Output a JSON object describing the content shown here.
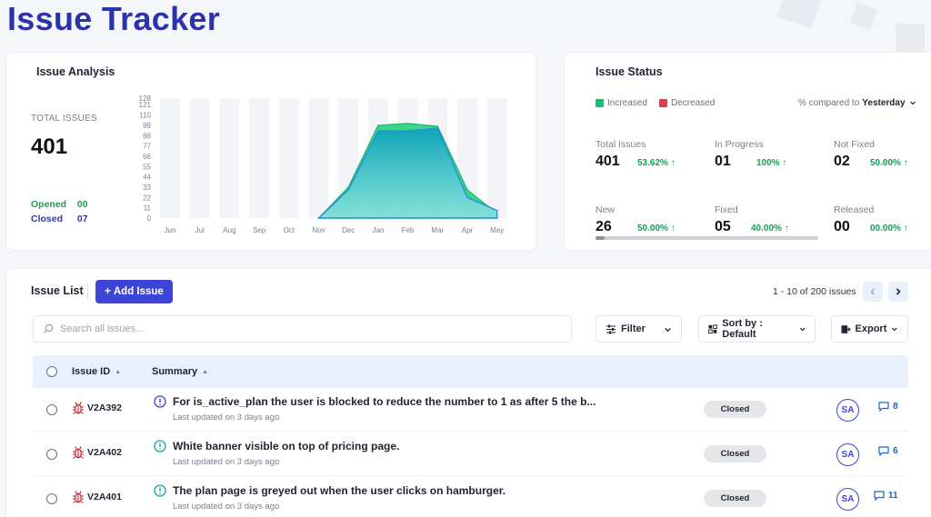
{
  "page_title": "Issue Tracker",
  "colors": {
    "brand": "#2c33a8",
    "primary_button": "#3d45d9",
    "increase": "#12c26b",
    "decrease": "#e83a4b",
    "opened": "#12a150",
    "closed": "#2c33c8"
  },
  "analysis": {
    "title": "Issue Analysis",
    "total_label": "TOTAL ISSUES",
    "total_value": "401",
    "opened_label": "Opened",
    "opened_value": "00",
    "closed_label": "Closed",
    "closed_value": "07"
  },
  "chart_data": {
    "type": "area",
    "categories": [
      "Jun",
      "Jul",
      "Aug",
      "Sep",
      "Oct",
      "Nov",
      "Dec",
      "Jan",
      "Feb",
      "Mar",
      "Apr",
      "May"
    ],
    "y_ticks": [
      0,
      11,
      22,
      33,
      44,
      55,
      66,
      77,
      88,
      99,
      110,
      121,
      128
    ],
    "ylim": [
      0,
      128
    ],
    "series": [
      {
        "values": [
          null,
          null,
          null,
          null,
          null,
          0,
          33,
          99,
          101,
          98,
          30,
          5
        ]
      },
      {
        "values": [
          null,
          null,
          null,
          null,
          null,
          0,
          30,
          93,
          93,
          96,
          22,
          8
        ]
      }
    ],
    "grid": false
  },
  "status": {
    "title": "Issue Status",
    "legend_increased": "Increased",
    "legend_decreased": "Decreased",
    "compare_label": "% compared to",
    "compare_value": "Yesterday",
    "stats": [
      {
        "label": "Total Issues",
        "value": "401",
        "pct": "53.62%"
      },
      {
        "label": "In Progress",
        "value": "01",
        "pct": "100%"
      },
      {
        "label": "Not Fixed",
        "value": "02",
        "pct": "50.00%"
      },
      {
        "label": "New",
        "value": "26",
        "pct": "50.00%"
      },
      {
        "label": "Fixed",
        "value": "05",
        "pct": "40.00%"
      },
      {
        "label": "Released",
        "value": "00",
        "pct": "00.00%"
      }
    ],
    "progress": 0.04
  },
  "issue_list": {
    "title": "Issue List",
    "add_label": "Add Issue",
    "pagination": "1 - 10 of 200 issues",
    "search_placeholder": "Search all issues...",
    "filter_label": "Filter",
    "sort_label": "Sort by : Default",
    "export_label": "Export",
    "col_id": "Issue ID",
    "col_summary": "Summary",
    "rows": [
      {
        "id": "V2A392",
        "summary": "For is_active_plan the user is blocked to reduce the number to 1 as after 5 the b...",
        "updated": "Last updated on 3 days ago",
        "status": "Closed",
        "assignee": "SA",
        "comments": "8"
      },
      {
        "id": "V2A402",
        "summary": "White banner visible on top of pricing page.",
        "updated": "Last updated on 3 days ago",
        "status": "Closed",
        "assignee": "SA",
        "comments": "6"
      },
      {
        "id": "V2A401",
        "summary": "The plan page is greyed out when the user clicks on hamburger.",
        "updated": "Last updated on 3 days ago",
        "status": "Closed",
        "assignee": "SA",
        "comments": "11"
      }
    ]
  }
}
